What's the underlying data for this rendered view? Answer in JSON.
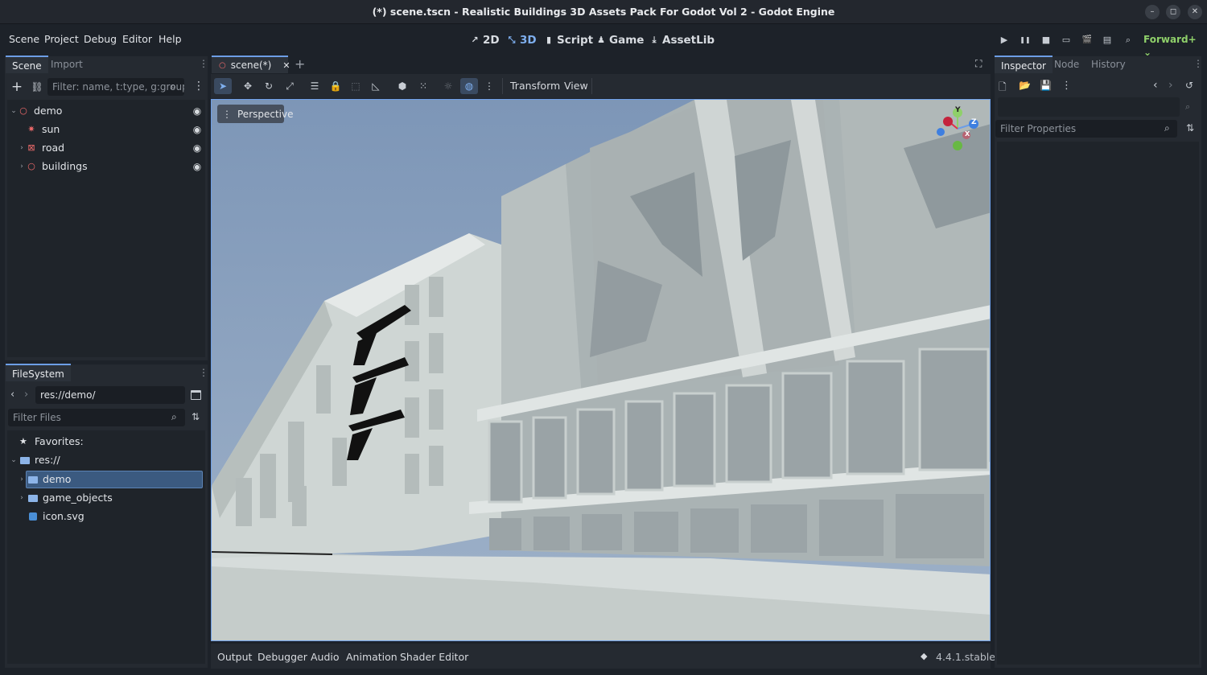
{
  "window": {
    "title": "(*) scene.tscn - Realistic Buildings 3D Assets Pack For Godot Vol 2 - Godot Engine",
    "controls": {
      "minimize": "–",
      "maximize": "◻",
      "close": "✕"
    }
  },
  "menu": [
    "Scene",
    "Project",
    "Debug",
    "Editor",
    "Help"
  ],
  "workspaces": [
    {
      "label": "2D",
      "icon": "↗",
      "active": false
    },
    {
      "label": "3D",
      "icon": "⤡",
      "active": true
    },
    {
      "label": "Script",
      "icon": "▮",
      "active": false
    },
    {
      "label": "Game",
      "icon": "♟",
      "active": false
    },
    {
      "label": "AssetLib",
      "icon": "⤓",
      "active": false
    }
  ],
  "run_controls": [
    "▶",
    "❚❚",
    "■",
    "▭",
    "🎬",
    "▤",
    "⌕"
  ],
  "renderer": "Forward+",
  "scene_dock": {
    "tabs": [
      "Scene",
      "Import"
    ],
    "filter_placeholder": "Filter: name, t:type, g:group",
    "nodes": [
      {
        "name": "demo",
        "icon": "○",
        "icon_color": "#f06b6b",
        "expanded": true,
        "indent": 0
      },
      {
        "name": "sun",
        "icon": "✷",
        "icon_color": "#f06b6b",
        "indent": 1
      },
      {
        "name": "road",
        "icon": "⊠",
        "icon_color": "#f06b6b",
        "indent": 1
      },
      {
        "name": "buildings",
        "icon": "○",
        "icon_color": "#f06b6b",
        "indent": 1
      }
    ]
  },
  "filesystem": {
    "tab": "FileSystem",
    "path": "res://demo/",
    "filter_placeholder": "Filter Files",
    "favorites_label": "Favorites:",
    "items": [
      {
        "name": "res://",
        "icon": "folder"
      },
      {
        "name": "demo",
        "icon": "folder",
        "selected": true
      },
      {
        "name": "game_objects",
        "icon": "folder"
      },
      {
        "name": "icon.svg",
        "icon": "image"
      }
    ]
  },
  "editor": {
    "tab_label": "scene(*)",
    "toolbar_menus": [
      "Transform",
      "View"
    ],
    "viewport_label": "Perspective",
    "gizmo_axes": {
      "x": "X",
      "y": "Y",
      "z": "Z"
    }
  },
  "bottom_panel": {
    "tabs": [
      "Output",
      "Debugger",
      "Audio",
      "Animation",
      "Shader Editor"
    ],
    "version": "4.4.1.stable"
  },
  "inspector": {
    "tabs": [
      "Inspector",
      "Node",
      "History"
    ],
    "filter_placeholder": "Filter Properties"
  },
  "colors": {
    "accent": "#6d9ee6",
    "renderer": "#8fd06a",
    "node_icon": "#f06b6b",
    "sky": "#7f98b9"
  }
}
